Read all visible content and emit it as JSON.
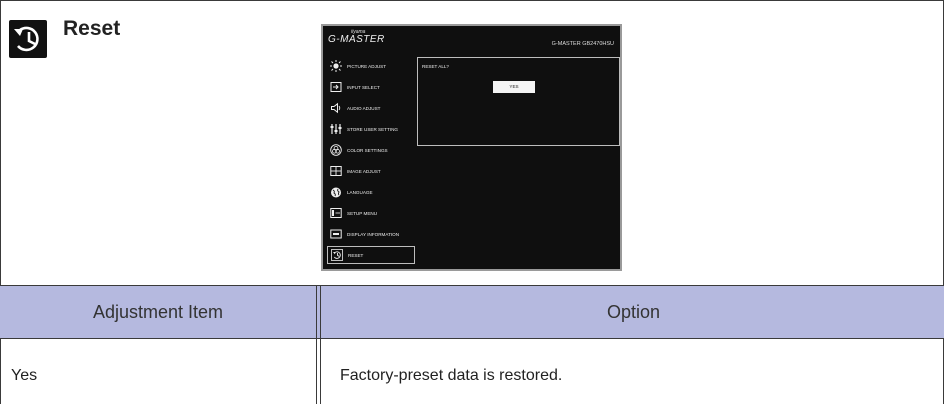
{
  "section": {
    "title": "Reset",
    "icon": "reset-clock-icon"
  },
  "osd": {
    "brand_small": "iiyama",
    "brand": "G-MASTER",
    "model": "G-MASTER GB2470HSU",
    "menu": [
      {
        "label": "PICTURE ADJUST",
        "icon": "brightness-icon"
      },
      {
        "label": "INPUT SELECT",
        "icon": "input-icon"
      },
      {
        "label": "AUDIO ADJUST",
        "icon": "speaker-icon"
      },
      {
        "label": "STORE USER SETTING",
        "icon": "user-setting-icon"
      },
      {
        "label": "COLOR SETTINGS",
        "icon": "color-icon"
      },
      {
        "label": "IMAGE ADJUST",
        "icon": "image-adjust-icon"
      },
      {
        "label": "LANGUAGE",
        "icon": "globe-icon"
      },
      {
        "label": "SETUP MENU",
        "icon": "setup-icon"
      },
      {
        "label": "DISPLAY INFORMATION",
        "icon": "display-info-icon"
      },
      {
        "label": "RESET",
        "icon": "reset-icon"
      }
    ],
    "selected_index": 9,
    "panel": {
      "title": "RESET ALL?",
      "button": "YES"
    }
  },
  "table": {
    "headers": [
      "Adjustment Item",
      "Option"
    ],
    "rows": [
      {
        "item": "Yes",
        "option": "Factory-preset data is restored."
      }
    ],
    "header_color": "#b5b9df"
  }
}
